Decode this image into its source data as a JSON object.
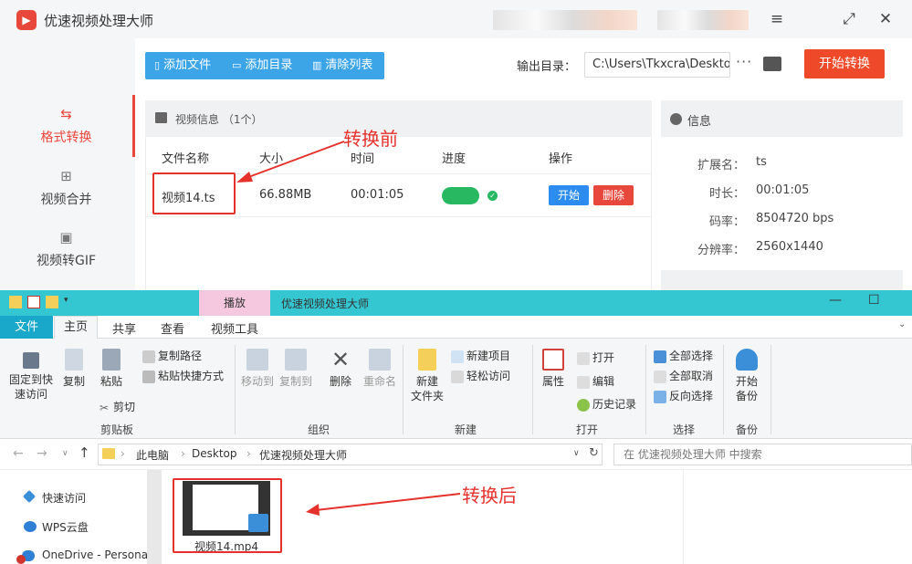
{
  "app": {
    "title": "优速视频处理大师",
    "sidebar": [
      {
        "label": "格式转换",
        "icon": "refresh-icon"
      },
      {
        "label": "视频合并",
        "icon": "merge-icon"
      },
      {
        "label": "视频转GIF",
        "icon": "gif-icon"
      }
    ],
    "toolbar": {
      "add_file": "添加文件",
      "add_dir": "添加目录",
      "clear": "清除列表"
    },
    "output_label": "输出目录：",
    "output_path": "C:\\Users\\Tkxcra\\Desktop",
    "more": "···",
    "start_convert": "开始转换",
    "video_panel": {
      "title": "视频信息 （1个）",
      "columns": [
        "文件名称",
        "大小",
        "时间",
        "进度",
        "操作"
      ],
      "rows": [
        {
          "name": "视频14.ts",
          "size": "66.88MB",
          "time": "00:01:05",
          "progress": 1.0,
          "start": "开始",
          "delete": "删除"
        }
      ]
    },
    "info_panel": {
      "title": "信息",
      "fields": [
        {
          "k": "扩展名：",
          "v": "ts"
        },
        {
          "k": "时长：",
          "v": "00:01:05"
        },
        {
          "k": "码率：",
          "v": "8504720 bps"
        },
        {
          "k": "分辨率：",
          "v": "2560x1440"
        }
      ]
    },
    "annotation_before": "转换前"
  },
  "explorer": {
    "context_tab": "播放",
    "title": "优速视频处理大师",
    "tabs": [
      "文件",
      "主页",
      "共享",
      "查看",
      "视频工具"
    ],
    "ribbon": {
      "pin": "固定到快\n速访问",
      "copy": "复制",
      "paste": "粘贴",
      "copy_path": "复制路径",
      "paste_shortcut": "粘贴快捷方式",
      "cut": "剪切",
      "move_to": "移动到",
      "copy_to": "复制到",
      "delete": "删除",
      "rename": "重命名",
      "new_folder": "新建\n文件夹",
      "new_item": "新建项目",
      "easy_access": "轻松访问",
      "properties": "属性",
      "open": "打开",
      "edit": "编辑",
      "history": "历史记录",
      "select_all": "全部选择",
      "select_none": "全部取消",
      "invert": "反向选择",
      "backup": "开始\n备份",
      "groups": {
        "clipboard": "剪贴板",
        "organize": "组织",
        "new": "新建",
        "open": "打开",
        "select": "选择",
        "backup": "备份"
      }
    },
    "breadcrumb": [
      "此电脑",
      "Desktop",
      "优速视频处理大师"
    ],
    "search_placeholder": "在 优速视频处理大师 中搜索",
    "nav": [
      "快速访问",
      "WPS云盘",
      "OneDrive - Persona"
    ],
    "file_name": "视频14.mp4",
    "annotation_after": "转换后"
  }
}
